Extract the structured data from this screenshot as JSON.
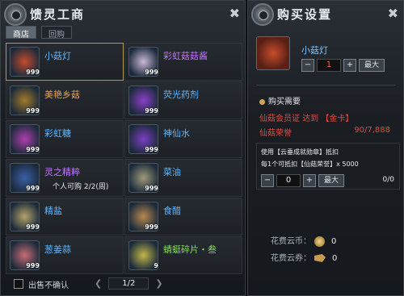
{
  "shop": {
    "title": "馈灵工商",
    "tabs": [
      "商店",
      "回购"
    ],
    "items": [
      {
        "name": "小菇灯",
        "count": "999",
        "name_color": "#5fb7ff",
        "icon_color": "#c44b2e",
        "selected": true,
        "icon": "mushroom-lamp-icon"
      },
      {
        "name": "彩虹菇菇酱",
        "count": "999",
        "name_color": "#c173ff",
        "icon_color": "#c9b8d8",
        "selected": false,
        "icon": "rainbow-sauce-icon"
      },
      {
        "name": "美艳乡菇",
        "count": "999",
        "name_color": "#e9a54a",
        "icon_color": "#a37a2a",
        "selected": false,
        "icon": "mushroom-icon"
      },
      {
        "name": "荧光药剂",
        "count": "999",
        "name_color": "#5fb7ff",
        "icon_color": "#8a3fc8",
        "selected": false,
        "icon": "potion-icon"
      },
      {
        "name": "彩虹糖",
        "count": "999",
        "name_color": "#5fb7ff",
        "icon_color": "#b03fae",
        "selected": false,
        "icon": "rainbow-candy-icon"
      },
      {
        "name": "神仙水",
        "count": "999",
        "name_color": "#5fb7ff",
        "icon_color": "#7b3fc4",
        "selected": false,
        "icon": "fairy-water-icon"
      },
      {
        "name": "灵之精粹",
        "count": "999",
        "name_color": "#c173ff",
        "icon_color": "#3b5fa8",
        "selected": false,
        "icon": "crystal-icon",
        "sub": "个人可购 2/2(周)"
      },
      {
        "name": "菜油",
        "count": "999",
        "name_color": "#5fb7ff",
        "icon_color": "#9f9a7a",
        "selected": false,
        "icon": "oil-icon"
      },
      {
        "name": "精盐",
        "count": "999",
        "name_color": "#5fb7ff",
        "icon_color": "#b4a36a",
        "selected": false,
        "icon": "salt-icon"
      },
      {
        "name": "食醋",
        "count": "999",
        "name_color": "#5fb7ff",
        "icon_color": "#b8884f",
        "selected": false,
        "icon": "vinegar-icon"
      },
      {
        "name": "葱姜蒜",
        "count": "999",
        "name_color": "#5fb7ff",
        "icon_color": "#c86c76",
        "selected": false,
        "icon": "garlic-icon"
      },
      {
        "name": "蜻蜓碎片・叁",
        "count": "9",
        "name_color": "#7fe04b",
        "icon_color": "#c2b64a",
        "selected": false,
        "icon": "dragonfly-shard-icon"
      }
    ],
    "footer": {
      "checkbox_label": "出售不确认",
      "page_text": "1/2"
    }
  },
  "purchase": {
    "title": "购买设置",
    "item_name": "小菇灯",
    "quantity": "1",
    "max_label": "最大",
    "minus_label": "−",
    "plus_label": "+",
    "need_label": "购买需要",
    "requirement_1": "仙菇会员证 达到 【金卡】",
    "requirement_2_label": "仙菇荣誉",
    "requirement_2_value": "90/7,888",
    "deduct_line_1": "使用【云垂成就勋章】抵扣",
    "deduct_line_2": "每1个可抵扣【仙菇荣誉】x 5000",
    "deduct_qty": "0",
    "deduct_ratio": "0/0",
    "cost_coin_label": "花费云币：",
    "cost_coin_value": "0",
    "cost_ticket_label": "花费云券：",
    "cost_ticket_value": "0"
  }
}
